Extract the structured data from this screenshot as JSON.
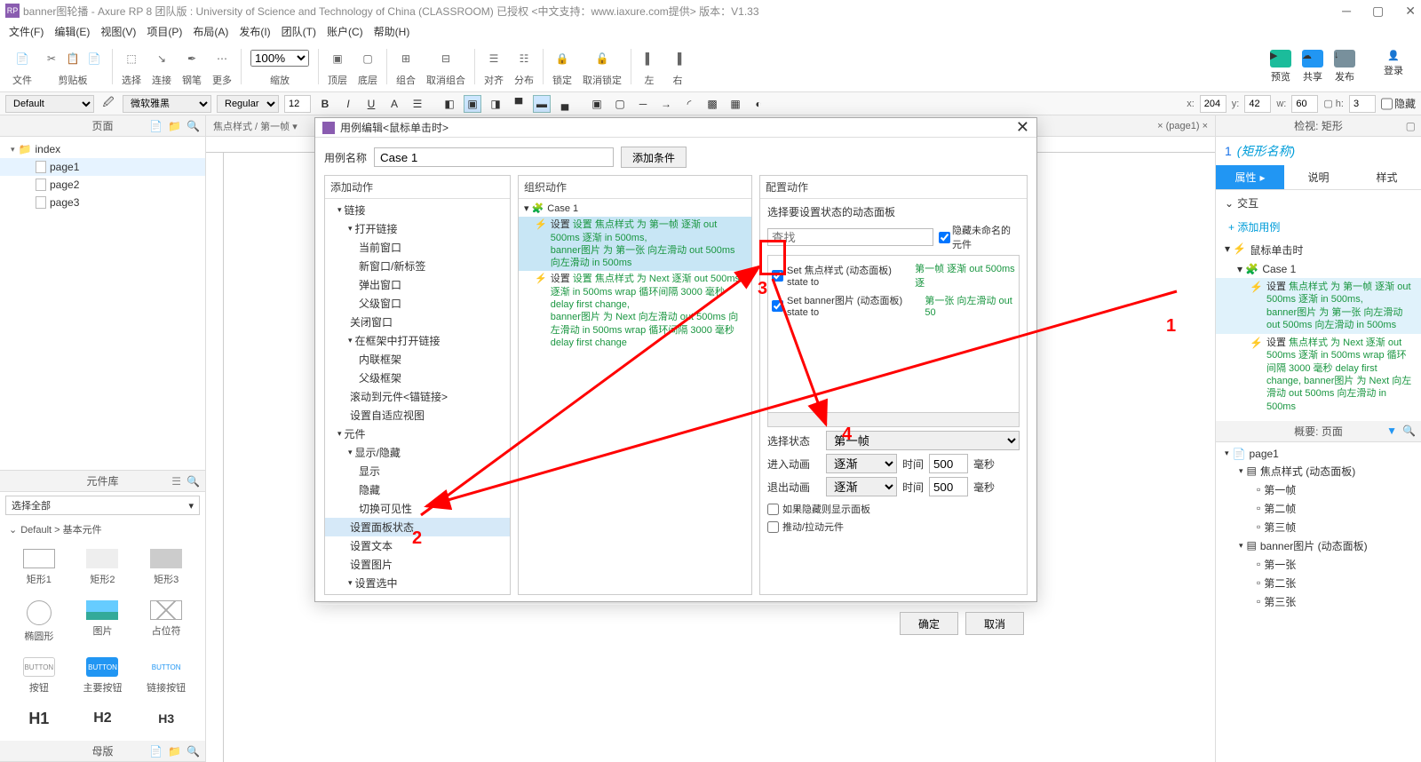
{
  "titlebar": {
    "text": "banner图轮播 - Axure RP 8 团队版 : University of Science and Technology of China (CLASSROOM) 已授权    <中文支持：www.iaxure.com提供>  版本：V1.33"
  },
  "menu": [
    "文件(F)",
    "编辑(E)",
    "视图(V)",
    "项目(P)",
    "布局(A)",
    "发布(I)",
    "团队(T)",
    "账户(C)",
    "帮助(H)"
  ],
  "toolbar1": {
    "groups": [
      "文件",
      "剪贴板",
      "选择",
      "连接",
      "钢笔",
      "更多",
      "缩放",
      "顶层",
      "底层",
      "组合",
      "取消组合",
      "对齐",
      "分布",
      "锁定",
      "取消锁定",
      "左",
      "右"
    ],
    "zoom": "100%",
    "right": {
      "preview": "预览",
      "share": "共享",
      "publish": "发布",
      "login": "登录"
    }
  },
  "toolbar2": {
    "style_preset": "Default",
    "font": "微软雅黑",
    "weight": "Regular",
    "size": "12",
    "x": "204",
    "y": "42",
    "w": "60",
    "h": "3",
    "hidden": "隐藏"
  },
  "pages": {
    "title": "页面",
    "root": "index",
    "items": [
      "page1",
      "page2",
      "page3"
    ]
  },
  "lib": {
    "title": "元件库",
    "select": "选择全部",
    "group": "Default > 基本元件",
    "cells": [
      "矩形1",
      "矩形2",
      "矩形3",
      "椭圆形",
      "图片",
      "占位符",
      "按钮",
      "主要按钮",
      "链接按钮",
      "H1",
      "H2",
      "H3"
    ],
    "master": "母版"
  },
  "canvas_tab": "焦点样式 / 第一帧 ▾",
  "right": {
    "inspect_title": "检视: 矩形",
    "shape_name": "(矩形名称)",
    "num": "1",
    "tabs": [
      "属性",
      "说明",
      "样式"
    ],
    "ix_hdr": "交互",
    "add_case": "添加用例",
    "event": "鼠标单击时",
    "case": "Case 1",
    "action1_pre": "设置 ",
    "action1_hl1": "焦点样式 为 第一帧 逐渐 out 500ms 逐渐 in 500ms,",
    "action1_hl2": "banner图片 为 第一张 向左滑动 out 500ms 向左滑动 in 500ms",
    "action2_pre": "设置 ",
    "action2_hl": "焦点样式 为 Next 逐渐 out 500ms 逐渐 in 500ms wrap 循环间隔 3000 毫秒 delay first change, banner图片 为 Next 向左滑动 out 500ms 向左滑动 in 500ms",
    "overview_title": "概要: 页面",
    "outline": [
      {
        "l": 1,
        "txt": "page1",
        "ic": "pg"
      },
      {
        "l": 2,
        "txt": "焦点样式 (动态面板)",
        "ic": "dp"
      },
      {
        "l": 3,
        "txt": "第一帧",
        "ic": "st"
      },
      {
        "l": 3,
        "txt": "第二帧",
        "ic": "st"
      },
      {
        "l": 3,
        "txt": "第三帧",
        "ic": "st"
      },
      {
        "l": 2,
        "txt": "banner图片 (动态面板)",
        "ic": "dp"
      },
      {
        "l": 3,
        "txt": "第一张",
        "ic": "st"
      },
      {
        "l": 3,
        "txt": "第二张",
        "ic": "st"
      },
      {
        "l": 3,
        "txt": "第三张",
        "ic": "st"
      }
    ]
  },
  "modal": {
    "title": "用例编辑<鼠标单击时>",
    "case_label": "用例名称",
    "case_name": "Case 1",
    "add_cond": "添加条件",
    "col1_hdr": "添加动作",
    "col2_hdr": "组织动作",
    "col3_hdr": "配置动作",
    "col1": [
      {
        "t": "cat",
        "l": 1,
        "txt": "链接"
      },
      {
        "t": "cat",
        "l": 2,
        "txt": "打开链接"
      },
      {
        "t": "item",
        "l": 3,
        "txt": "当前窗口"
      },
      {
        "t": "item",
        "l": 3,
        "txt": "新窗口/新标签"
      },
      {
        "t": "item",
        "l": 3,
        "txt": "弹出窗口"
      },
      {
        "t": "item",
        "l": 3,
        "txt": "父级窗口"
      },
      {
        "t": "item",
        "l": 2,
        "txt": "关闭窗口"
      },
      {
        "t": "cat",
        "l": 2,
        "txt": "在框架中打开链接"
      },
      {
        "t": "item",
        "l": 3,
        "txt": "内联框架"
      },
      {
        "t": "item",
        "l": 3,
        "txt": "父级框架"
      },
      {
        "t": "item",
        "l": 2,
        "txt": "滚动到元件<锚链接>"
      },
      {
        "t": "item",
        "l": 2,
        "txt": "设置自适应视图"
      },
      {
        "t": "cat",
        "l": 1,
        "txt": "元件"
      },
      {
        "t": "cat",
        "l": 2,
        "txt": "显示/隐藏"
      },
      {
        "t": "item",
        "l": 3,
        "txt": "显示"
      },
      {
        "t": "item",
        "l": 3,
        "txt": "隐藏"
      },
      {
        "t": "item",
        "l": 3,
        "txt": "切换可见性"
      },
      {
        "t": "item",
        "l": 2,
        "txt": "设置面板状态",
        "hl": true
      },
      {
        "t": "item",
        "l": 2,
        "txt": "设置文本"
      },
      {
        "t": "item",
        "l": 2,
        "txt": "设置图片"
      },
      {
        "t": "cat",
        "l": 2,
        "txt": "设置选中"
      }
    ],
    "col2_case": "Case 1",
    "col2_a1": "设置 焦点样式 为 第一帧 逐渐 out 500ms 逐渐 in 500ms,",
    "col2_a1b": "banner图片 为 第一张 向左滑动 out 500ms 向左滑动 in 500ms",
    "col2_a2": "设置 焦点样式 为 Next 逐渐 out 500ms 逐渐 in 500ms wrap 循环间隔 3000 毫秒 delay first change,",
    "col2_a2b": "banner图片 为 Next 向左滑动 out 500ms 向左滑动 in 500ms wrap 循环间隔 3000 毫秒 delay first change",
    "col3_subtitle": "选择要设置状态的动态面板",
    "search_ph": "查找",
    "hide_unnamed": "隐藏未命名的元件",
    "target1": "Set 焦点样式 (动态面板) state to ",
    "target1_grn": "第一帧 逐渐 out 500ms 逐",
    "target2": "Set banner图片 (动态面板) state to ",
    "target2_grn": "第一张 向左滑动 out 50",
    "sel_state_lbl": "选择状态",
    "sel_state": "第一帧",
    "anim_in_lbl": "进入动画",
    "anim_out_lbl": "退出动画",
    "anim_type": "逐渐",
    "anim_time_lbl": "时间",
    "anim_time": "500",
    "anim_unit": "毫秒",
    "cb_show": "如果隐藏则显示面板",
    "cb_push": "推动/拉动元件",
    "ok": "确定",
    "cancel": "取消"
  },
  "anno": {
    "n1": "1",
    "n2": "2",
    "n3": "3",
    "n4": "4"
  }
}
